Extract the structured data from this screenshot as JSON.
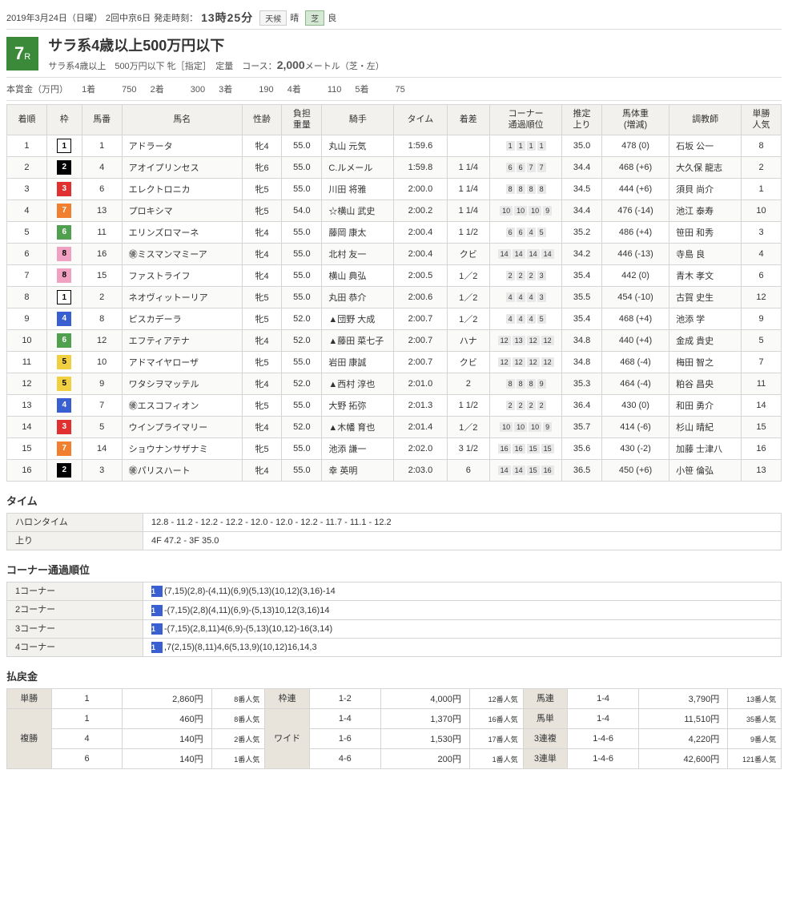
{
  "header": {
    "date": "2019年3月24日（日曜）",
    "meeting": "2回中京6日",
    "start_label": "発走時刻：",
    "start_time": "13時25分",
    "weather_label": "天候",
    "weather": "晴",
    "turf_label": "芝",
    "turf": "良"
  },
  "race": {
    "number": "7",
    "r": "R",
    "title": "サラ系4歳以上500万円以下",
    "subtitle": "サラ系4歳以上　500万円以下 牝［指定］　定量　コース：",
    "distance": "2,000",
    "distance_suffix": "メートル（芝・左）"
  },
  "prize": {
    "label": "本賞金（万円）",
    "items": [
      "1着　　　750",
      "2着　　　300",
      "3着　　　190",
      "4着　　　110",
      "5着　　　75"
    ]
  },
  "columns": {
    "rank": "着順",
    "waku": "枠",
    "num": "馬番",
    "name": "馬名",
    "sex": "性齢",
    "weight": "負担\n重量",
    "jockey": "騎手",
    "time": "タイム",
    "margin": "着差",
    "corner": "コーナー\n通過順位",
    "agari": "推定\n上り",
    "bweight": "馬体重\n(増減)",
    "trainer": "調教師",
    "pop": "単勝\n人気"
  },
  "rows": [
    {
      "rank": "1",
      "waku": "1",
      "wc": "w1",
      "num": "1",
      "name": "アドラータ",
      "sex": "牝4",
      "wt": "55.0",
      "jockey": "丸山 元気",
      "time": "1:59.6",
      "margin": "",
      "corner": [
        "1",
        "1",
        "1",
        "1"
      ],
      "agari": "35.0",
      "bw": "478 (0)",
      "trainer": "石坂 公一",
      "pop": "8"
    },
    {
      "rank": "2",
      "waku": "2",
      "wc": "w2",
      "num": "4",
      "name": "アオイプリンセス",
      "sex": "牝6",
      "wt": "55.0",
      "jockey": "C.ルメール",
      "time": "1:59.8",
      "margin": "1 1/4",
      "corner": [
        "6",
        "6",
        "7",
        "7"
      ],
      "agari": "34.4",
      "bw": "468 (+6)",
      "trainer": "大久保 龍志",
      "pop": "2"
    },
    {
      "rank": "3",
      "waku": "3",
      "wc": "w3",
      "num": "6",
      "name": "エレクトロニカ",
      "sex": "牝5",
      "wt": "55.0",
      "jockey": "川田 将雅",
      "time": "2:00.0",
      "margin": "1 1/4",
      "corner": [
        "8",
        "8",
        "8",
        "8"
      ],
      "agari": "34.5",
      "bw": "444 (+6)",
      "trainer": "須貝 尚介",
      "pop": "1"
    },
    {
      "rank": "4",
      "waku": "7",
      "wc": "w7",
      "num": "13",
      "name": "プロキシマ",
      "sex": "牝5",
      "wt": "54.0",
      "jockey": "☆横山 武史",
      "time": "2:00.2",
      "margin": "1 1/4",
      "corner": [
        "10",
        "10",
        "10",
        "9"
      ],
      "agari": "34.4",
      "bw": "476 (-14)",
      "trainer": "池江 泰寿",
      "pop": "10"
    },
    {
      "rank": "5",
      "waku": "6",
      "wc": "w6",
      "num": "11",
      "name": "エリンズロマーネ",
      "sex": "牝4",
      "wt": "55.0",
      "jockey": "藤岡 康太",
      "time": "2:00.4",
      "margin": "1 1/2",
      "corner": [
        "6",
        "6",
        "4",
        "5"
      ],
      "agari": "35.2",
      "bw": "486 (+4)",
      "trainer": "笹田 和秀",
      "pop": "3"
    },
    {
      "rank": "6",
      "waku": "8",
      "wc": "w8",
      "num": "16",
      "name": "㊝ミスマンマミーア",
      "sex": "牝4",
      "wt": "55.0",
      "jockey": "北村 友一",
      "time": "2:00.4",
      "margin": "クビ",
      "corner": [
        "14",
        "14",
        "14",
        "14"
      ],
      "agari": "34.2",
      "bw": "446 (-13)",
      "trainer": "寺島 良",
      "pop": "4"
    },
    {
      "rank": "7",
      "waku": "8",
      "wc": "w8",
      "num": "15",
      "name": "ファストライフ",
      "sex": "牝4",
      "wt": "55.0",
      "jockey": "横山 典弘",
      "time": "2:00.5",
      "margin": "1／2",
      "corner": [
        "2",
        "2",
        "2",
        "3"
      ],
      "agari": "35.4",
      "bw": "442 (0)",
      "trainer": "青木 孝文",
      "pop": "6"
    },
    {
      "rank": "8",
      "waku": "1",
      "wc": "w1",
      "num": "2",
      "name": "ネオヴィットーリア",
      "sex": "牝5",
      "wt": "55.0",
      "jockey": "丸田 恭介",
      "time": "2:00.6",
      "margin": "1／2",
      "corner": [
        "4",
        "4",
        "4",
        "3"
      ],
      "agari": "35.5",
      "bw": "454 (-10)",
      "trainer": "古賀 史生",
      "pop": "12"
    },
    {
      "rank": "9",
      "waku": "4",
      "wc": "w4",
      "num": "8",
      "name": "ピスカデーラ",
      "sex": "牝5",
      "wt": "52.0",
      "jockey": "▲団野 大成",
      "time": "2:00.7",
      "margin": "1／2",
      "corner": [
        "4",
        "4",
        "4",
        "5"
      ],
      "agari": "35.4",
      "bw": "468 (+4)",
      "trainer": "池添 学",
      "pop": "9"
    },
    {
      "rank": "10",
      "waku": "6",
      "wc": "w6",
      "num": "12",
      "name": "エフティアテナ",
      "sex": "牝4",
      "wt": "52.0",
      "jockey": "▲藤田 菜七子",
      "time": "2:00.7",
      "margin": "ハナ",
      "corner": [
        "12",
        "13",
        "12",
        "12"
      ],
      "agari": "34.8",
      "bw": "440 (+4)",
      "trainer": "金成 貴史",
      "pop": "5"
    },
    {
      "rank": "11",
      "waku": "5",
      "wc": "w5",
      "num": "10",
      "name": "アドマイヤローザ",
      "sex": "牝5",
      "wt": "55.0",
      "jockey": "岩田 康誠",
      "time": "2:00.7",
      "margin": "クビ",
      "corner": [
        "12",
        "12",
        "12",
        "12"
      ],
      "agari": "34.8",
      "bw": "468 (-4)",
      "trainer": "梅田 智之",
      "pop": "7"
    },
    {
      "rank": "12",
      "waku": "5",
      "wc": "w5",
      "num": "9",
      "name": "ワタシヲマッテル",
      "sex": "牝4",
      "wt": "52.0",
      "jockey": "▲西村 淳也",
      "time": "2:01.0",
      "margin": "2",
      "corner": [
        "8",
        "8",
        "8",
        "9"
      ],
      "agari": "35.3",
      "bw": "464 (-4)",
      "trainer": "粕谷 昌央",
      "pop": "11"
    },
    {
      "rank": "13",
      "waku": "4",
      "wc": "w4",
      "num": "7",
      "name": "㊝エスコフィオン",
      "sex": "牝5",
      "wt": "55.0",
      "jockey": "大野 拓弥",
      "time": "2:01.3",
      "margin": "1 1/2",
      "corner": [
        "2",
        "2",
        "2",
        "2"
      ],
      "agari": "36.4",
      "bw": "430 (0)",
      "trainer": "和田 勇介",
      "pop": "14"
    },
    {
      "rank": "14",
      "waku": "3",
      "wc": "w3",
      "num": "5",
      "name": "ウインプライマリー",
      "sex": "牝4",
      "wt": "52.0",
      "jockey": "▲木幡 育也",
      "time": "2:01.4",
      "margin": "1／2",
      "corner": [
        "10",
        "10",
        "10",
        "9"
      ],
      "agari": "35.7",
      "bw": "414 (-6)",
      "trainer": "杉山 晴紀",
      "pop": "15"
    },
    {
      "rank": "15",
      "waku": "7",
      "wc": "w7",
      "num": "14",
      "name": "ショウナンサザナミ",
      "sex": "牝5",
      "wt": "55.0",
      "jockey": "池添 謙一",
      "time": "2:02.0",
      "margin": "3 1/2",
      "corner": [
        "16",
        "16",
        "15",
        "15"
      ],
      "agari": "35.6",
      "bw": "430 (-2)",
      "trainer": "加藤 士津八",
      "pop": "16"
    },
    {
      "rank": "16",
      "waku": "2",
      "wc": "w2",
      "num": "3",
      "name": "㊝パリスハート",
      "sex": "牝4",
      "wt": "55.0",
      "jockey": "幸 英明",
      "time": "2:03.0",
      "margin": "6",
      "corner": [
        "14",
        "14",
        "15",
        "16"
      ],
      "agari": "36.5",
      "bw": "450 (+6)",
      "trainer": "小笹 倫弘",
      "pop": "13"
    }
  ],
  "time_section": {
    "title": "タイム",
    "harron_label": "ハロンタイム",
    "harron": "12.8 - 11.2 - 12.2 - 12.2 - 12.0 - 12.0 - 12.2 - 11.7 - 11.1 - 12.2",
    "agari_label": "上り",
    "agari": "4F 47.2 - 3F 35.0"
  },
  "corner_section": {
    "title": "コーナー通過順位",
    "rows": [
      {
        "label": "1コーナー",
        "waku": "1",
        "wc": "w4",
        "text": "(7,15)(2,8)-(4,11)(6,9)(5,13)(10,12)(3,16)-14"
      },
      {
        "label": "2コーナー",
        "waku": "1",
        "wc": "w4",
        "text": "-(7,15)(2,8)(4,11)(6,9)-(5,13)10,12(3,16)14"
      },
      {
        "label": "3コーナー",
        "waku": "1",
        "wc": "w4",
        "text": "-(7,15)(2,8,11)4(6,9)-(5,13)(10,12)-16(3,14)"
      },
      {
        "label": "4コーナー",
        "waku": "1",
        "wc": "w4",
        "text": ",7(2,15)(8,11)4,6(5,13,9)(10,12)16,14,3"
      }
    ]
  },
  "payout_section": {
    "title": "払戻金",
    "rows": [
      {
        "type": "単勝",
        "combo": "1",
        "amt": "2,860円",
        "pop": "8番人気",
        "type2": "枠連",
        "combo2": "1-2",
        "amt2": "4,000円",
        "pop2": "12番人気",
        "type3": "馬連",
        "combo3": "1-4",
        "amt3": "3,790円",
        "pop3": "13番人気"
      },
      {
        "type": "複勝",
        "combo": "1",
        "amt": "460円",
        "pop": "8番人気",
        "type2": "ワイド",
        "combo2": "1-4",
        "amt2": "1,370円",
        "pop2": "16番人気",
        "type3": "馬単",
        "combo3": "1-4",
        "amt3": "11,510円",
        "pop3": "35番人気"
      },
      {
        "combo": "4",
        "amt": "140円",
        "pop": "2番人気",
        "combo2": "1-6",
        "amt2": "1,530円",
        "pop2": "17番人気",
        "type3": "3連複",
        "combo3": "1-4-6",
        "amt3": "4,220円",
        "pop3": "9番人気"
      },
      {
        "combo": "6",
        "amt": "140円",
        "pop": "1番人気",
        "combo2": "4-6",
        "amt2": "200円",
        "pop2": "1番人気",
        "type3": "3連単",
        "combo3": "1-4-6",
        "amt3": "42,600円",
        "pop3": "121番人気"
      }
    ]
  }
}
